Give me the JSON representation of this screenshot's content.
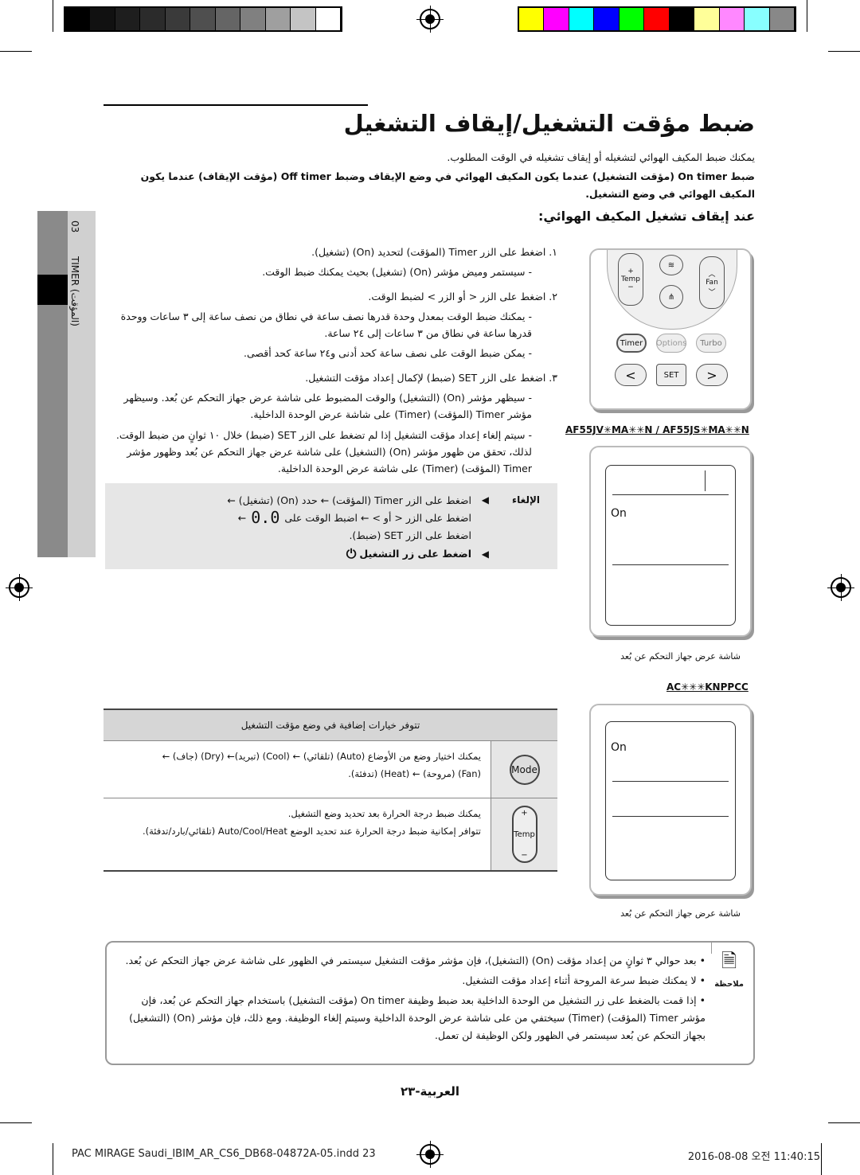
{
  "print_marks": {
    "grayscale": [
      "#000000",
      "#111111",
      "#1e1e1e",
      "#2b2b2b",
      "#3a3a3a",
      "#4f4f4f",
      "#656565",
      "#808080",
      "#9f9f9f",
      "#c4c4c4",
      "#ffffff"
    ],
    "colors": [
      "#ffff00",
      "#ff00ff",
      "#00ffff",
      "#0000ff",
      "#00ff00",
      "#ff0000",
      "#000000",
      "#ffff99",
      "#ff88ff",
      "#88ffff",
      "#888888"
    ]
  },
  "side_tab": {
    "number": "03",
    "label": "TIMER (المؤقت)"
  },
  "title": "ضبط مؤقت التشغيل/إيقاف التشغيل",
  "intro": {
    "line1": "يمكنك ضبط المكيف الهوائي لتشغيله أو إيقاف تشغيله في الوقت المطلوب.",
    "line2": "ضبط On timer (مؤقت التشغيل) عندما يكون المكيف الهوائي في وضع الإيقاف وضبط Off timer (مؤقت الإيقاف) عندما يكون المكيف الهوائي في وضع التشغيل."
  },
  "section_heading": "عند إيقاف تشغيل المكيف الهوائي:",
  "steps": [
    {
      "num": "١.",
      "text": "اضغط على الزر Timer (المؤقت) لتحديد (On) (تشغيل).",
      "bullets": [
        "سيستمر وميض مؤشر (On) (تشغيل) بحيث يمكنك ضبط الوقت."
      ]
    },
    {
      "num": "٢.",
      "text": "اضغط على الزر < أو الزر > لضبط الوقت.",
      "bullets": [
        "يمكنك ضبط الوقت بمعدل وحدة قدرها نصف ساعة في نطاق من نصف ساعة إلى ٣ ساعات ووحدة قدرها ساعة في نطاق من ٣ ساعات إلى ٢٤ ساعة.",
        "يمكن ضبط الوقت على نصف ساعة كحد أدنى و٢٤ ساعة كحد أقصى."
      ]
    },
    {
      "num": "٣.",
      "text": "اضغط على الزر SET (ضبط) لإكمال إعداد مؤقت التشغيل.",
      "bullets": [
        "سيظهر مؤشر (On) (التشغيل) والوقت المضبوط على شاشة عرض جهاز التحكم عن بُعد. وسيظهر مؤشر Timer (المؤقت) (Timer) على شاشة عرض الوحدة الداخلية.",
        "سيتم إلغاء إعداد مؤقت التشغيل إذا لم تضغط على الزر SET (ضبط) خلال ١٠ ثوانٍ من ضبط الوقت. لذلك، تحقق من ظهور مؤشر (On) (التشغيل) على شاشة عرض جهاز التحكم عن بُعد وظهور مؤشر Timer (المؤقت) (Timer) على شاشة عرض الوحدة الداخلية."
      ]
    }
  ],
  "cancel": {
    "label": "الإلغاء",
    "line1": "اضغط على الزر Timer (المؤقت) ← حدد (On) (تشغيل) ←",
    "line2a": "اضغط على الزر < أو > ← اضبط الوقت على",
    "line2_display": "0.0",
    "line2b": "←",
    "line3": "اضغط على الزر SET (ضبط).",
    "line4": "اضغط على زر التشغيل"
  },
  "remote": {
    "buttons": {
      "temp": "Temp",
      "fan": "Fan",
      "timer": "Timer",
      "options": "Options",
      "turbo": "Turbo",
      "left": "<",
      "set": "SET",
      "right": ">"
    },
    "model1": "AF55JV✳MA✳✳N / AF55JS✳MA✳✳N",
    "display1": "On",
    "caption1": "شاشة عرض جهاز التحكم عن بُعد",
    "model2": "AC✳✳✳KNPPCC",
    "display2": "On",
    "caption2": "شاشة عرض جهاز التحكم عن بُعد"
  },
  "options_table": {
    "header": "تتوفر خيارات إضافية في وضع مؤقت التشغيل",
    "rows": [
      {
        "icon_label": "Mode",
        "line1": "يمكنك اختيار وضع من الأوضاع (Auto) (تلقائي) ← (Cool) (تبريد)← (Dry) (جاف) ←",
        "line2": "(Fan) (مروحة) ← (Heat) (تدفئة)."
      },
      {
        "icon_label": "Temp",
        "line1": "يمكنك ضبط درجة الحرارة بعد تحديد وضع التشغيل.",
        "line2": "تتوافر إمكانية ضبط درجة الحرارة عند تحديد الوضع Auto/Cool/Heat (تلقائي/بارد/تدفئة)."
      }
    ]
  },
  "note": {
    "label": "ملاحظة",
    "items": [
      "بعد حوالي ٣ ثوانٍ من إعداد مؤقت (On) (التشغيل)، فإن مؤشر مؤقت التشغيل سيستمر في الظهور على شاشة عرض جهاز التحكم عن بُعد.",
      "لا يمكنك ضبط سرعة المروحة أثناء إعداد مؤقت التشغيل.",
      "إذا قمت بالضغط على زر التشغيل من الوحدة الداخلية بعد ضبط وظيفة On timer (مؤقت التشغيل) باستخدام جهاز التحكم عن بُعد، فإن مؤشر Timer (المؤقت) (Timer) سيختفي من على شاشة عرض الوحدة الداخلية وسيتم إلغاء الوظيفة. ومع ذلك، فإن مؤشر (On) (التشغيل) بجهاز التحكم عن بُعد سيستمر في الظهور ولكن الوظيفة لن تعمل."
    ]
  },
  "page_number": "العربية-٢٣",
  "footer": {
    "left": "PAC MIRAGE Saudi_IBIM_AR_CS6_DB68-04872A-05.indd   23",
    "right": "2016-08-08   오전 11:40:15"
  }
}
